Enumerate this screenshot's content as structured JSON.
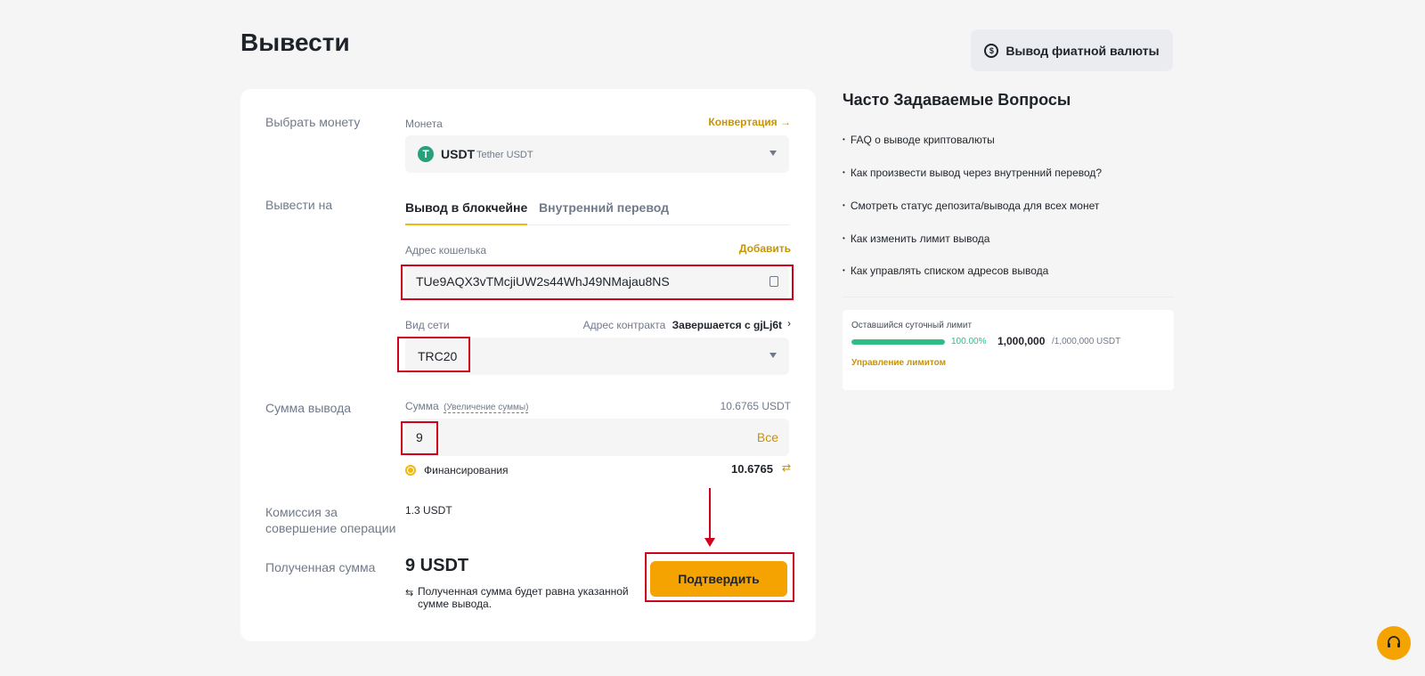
{
  "page": {
    "title": "Вывести"
  },
  "header": {
    "fiat_button": "Вывод фиатной валюты",
    "fiat_icon": "dollar-coin-icon"
  },
  "form": {
    "coin": {
      "row_label": "Выбрать монету",
      "field_label": "Монета",
      "convert_link": "Конвертация",
      "symbol": "USDT",
      "name": "Tether USDT",
      "icon_letter": "T",
      "icon_color": "#26a17b"
    },
    "withdraw_to": {
      "row_label": "Вывести на",
      "tabs": [
        {
          "label": "Вывод в блокчейне",
          "active": true
        },
        {
          "label": "Внутренний перевод",
          "active": false
        }
      ]
    },
    "address": {
      "field_label": "Адрес кошелька",
      "add_link": "Добавить",
      "value": "TUe9AQX3vTMcjiUW2s44WhJ49NMajau8NS"
    },
    "network": {
      "field_label": "Вид сети",
      "contract_label": "Адрес контракта",
      "contract_value": "Завершается с gjLj6t",
      "value": "TRC20"
    },
    "amount": {
      "row_label": "Сумма вывода",
      "field_label": "Сумма",
      "increase_link": "(Увеличение суммы)",
      "available": "10.6765 USDT",
      "value": "9",
      "all_button": "Все",
      "funding_label": "Финансирования",
      "funding_value": "10.6765"
    },
    "fee": {
      "row_label_1": "Комиссия за",
      "row_label_2": "совершение операции",
      "value": "1.3 USDT"
    },
    "received": {
      "row_label": "Полученная сумма",
      "value": "9 USDT",
      "note_1": "Полученная сумма будет равна указанной",
      "note_2": "сумме вывода."
    },
    "confirm_button": "Подтвердить"
  },
  "faq": {
    "title": "Часто Задаваемые Вопросы",
    "items": [
      "FAQ о выводе криптовалюты",
      "Как произвести вывод через внутренний перевод?",
      "Смотреть статус депозита/вывода для всех монет",
      "Как изменить лимит вывода",
      "Как управлять списком адресов вывода"
    ]
  },
  "limit": {
    "title": "Оставшийся суточный лимит",
    "percent": "100.00%",
    "progress_fraction": 1.0,
    "used": "1,000,000",
    "total": "/1,000,000 USDT",
    "manage_link": "Управление лимитом"
  },
  "colors": {
    "accent": "#f5a300",
    "link": "#c99400",
    "success": "#2ebd85",
    "annotation": "#d0021b"
  }
}
